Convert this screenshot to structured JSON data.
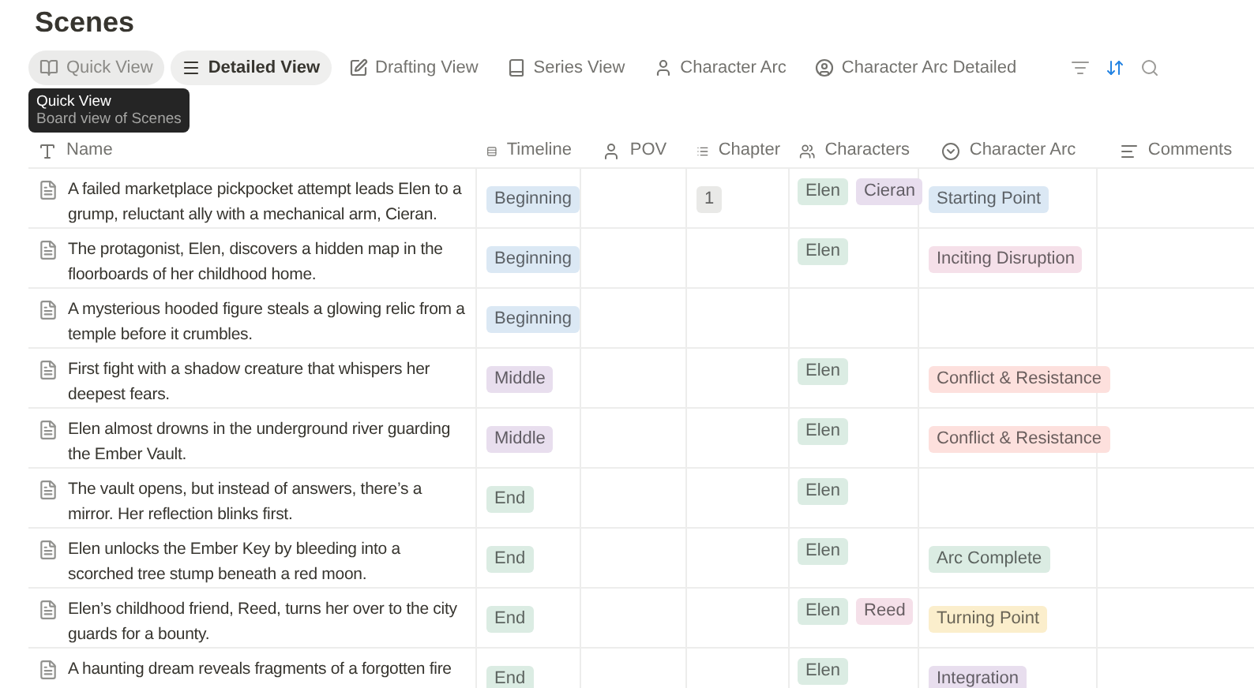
{
  "title": "Scenes",
  "tabs": [
    {
      "label": "Quick View",
      "selected": false,
      "hovered": true
    },
    {
      "label": "Detailed View",
      "selected": true,
      "hovered": false
    },
    {
      "label": "Drafting View",
      "selected": false,
      "hovered": false
    },
    {
      "label": "Series View",
      "selected": false,
      "hovered": false
    },
    {
      "label": "Character Arc",
      "selected": false,
      "hovered": false
    },
    {
      "label": "Character Arc Detailed",
      "selected": false,
      "hovered": false
    }
  ],
  "tooltip": {
    "title": "Quick View",
    "text": "Board view of Scenes"
  },
  "toolbar": {
    "sort_active": true
  },
  "columns": [
    "Name",
    "Timeline",
    "POV",
    "Chapter",
    "Characters",
    "Character Arc",
    "Comments"
  ],
  "rows": [
    {
      "name": "A failed marketplace pickpocket attempt leads Elen to a grump, reluctant ally with a mechanical arm, Cieran.",
      "timeline": {
        "label": "Beginning",
        "color": "#dbe8f4"
      },
      "chapter": {
        "label": "1",
        "color": "#e9e9e7"
      },
      "characters": [
        {
          "label": "Elen",
          "color": "#dbece3"
        },
        {
          "label": "Cieran",
          "color": "#e8deee"
        }
      ],
      "arc": {
        "label": "Starting Point",
        "color": "#dbe8f4"
      }
    },
    {
      "name": "The protagonist, Elen, discovers a hidden map in the floorboards of her childhood home.",
      "timeline": {
        "label": "Beginning",
        "color": "#dbe8f4"
      },
      "characters": [
        {
          "label": "Elen",
          "color": "#dbece3"
        }
      ],
      "arc": {
        "label": "Inciting Disruption",
        "color": "#f5e0e9"
      }
    },
    {
      "name": "A mysterious hooded figure steals a glowing relic from a temple before it crumbles.",
      "timeline": {
        "label": "Beginning",
        "color": "#dbe8f4"
      },
      "characters": []
    },
    {
      "name": "First fight with a shadow creature that whispers her deepest fears.",
      "timeline": {
        "label": "Middle",
        "color": "#e8deee"
      },
      "characters": [
        {
          "label": "Elen",
          "color": "#dbece3"
        }
      ],
      "arc": {
        "label": "Conflict & Resistance",
        "color": "#fde0dd"
      }
    },
    {
      "name": "Elen almost drowns in the underground river guarding the Ember Vault.",
      "timeline": {
        "label": "Middle",
        "color": "#e8deee"
      },
      "characters": [
        {
          "label": "Elen",
          "color": "#dbece3"
        }
      ],
      "arc": {
        "label": "Conflict & Resistance",
        "color": "#fde0dd"
      }
    },
    {
      "name": "The vault opens, but instead of answers, there’s a mirror. Her reflection blinks first.",
      "timeline": {
        "label": "End",
        "color": "#dbece3"
      },
      "characters": [
        {
          "label": "Elen",
          "color": "#dbece3"
        }
      ]
    },
    {
      "name": "Elen unlocks the Ember Key by bleeding into a scorched tree stump beneath a red moon.",
      "timeline": {
        "label": "End",
        "color": "#dbece3"
      },
      "characters": [
        {
          "label": "Elen",
          "color": "#dbece3"
        }
      ],
      "arc": {
        "label": "Arc Complete",
        "color": "#dbece3"
      }
    },
    {
      "name": "Elen’s childhood friend, Reed, turns her over to the city guards for a bounty.",
      "timeline": {
        "label": "End",
        "color": "#dbece3"
      },
      "characters": [
        {
          "label": "Elen",
          "color": "#dbece3"
        },
        {
          "label": "Reed",
          "color": "#f5e0e9"
        }
      ],
      "arc": {
        "label": "Turning Point",
        "color": "#fbeecc"
      }
    },
    {
      "name": "A haunting dream reveals fragments of a forgotten fire",
      "timeline": {
        "label": "End",
        "color": "#dbece3"
      },
      "characters": [
        {
          "label": "Elen",
          "color": "#dbece3"
        }
      ],
      "arc": {
        "label": "Integration",
        "color": "#e8deee"
      }
    }
  ]
}
